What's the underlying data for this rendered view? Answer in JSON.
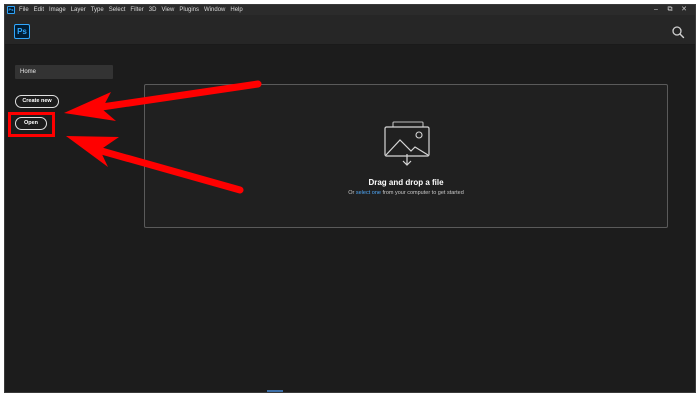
{
  "menubar": {
    "items": [
      "File",
      "Edit",
      "Image",
      "Layer",
      "Type",
      "Select",
      "Filter",
      "3D",
      "View",
      "Plugins",
      "Window",
      "Help"
    ]
  },
  "header": {
    "logo": "Ps",
    "search_icon": "search-icon"
  },
  "sidebar": {
    "home_label": "Home",
    "create_new_label": "Create new",
    "open_label": "Open"
  },
  "dropzone": {
    "icon": "image-drop-icon",
    "title": "Drag and drop a file",
    "sub_prefix": "Or ",
    "sub_link": "select one",
    "sub_suffix": " from your computer to get started"
  },
  "annotation": {
    "arrow_color": "#ff0000",
    "highlight_color": "#ff0000"
  },
  "colors": {
    "background": "#1c1c1c",
    "accent": "#31a8ff",
    "link": "#4fa8f7"
  }
}
